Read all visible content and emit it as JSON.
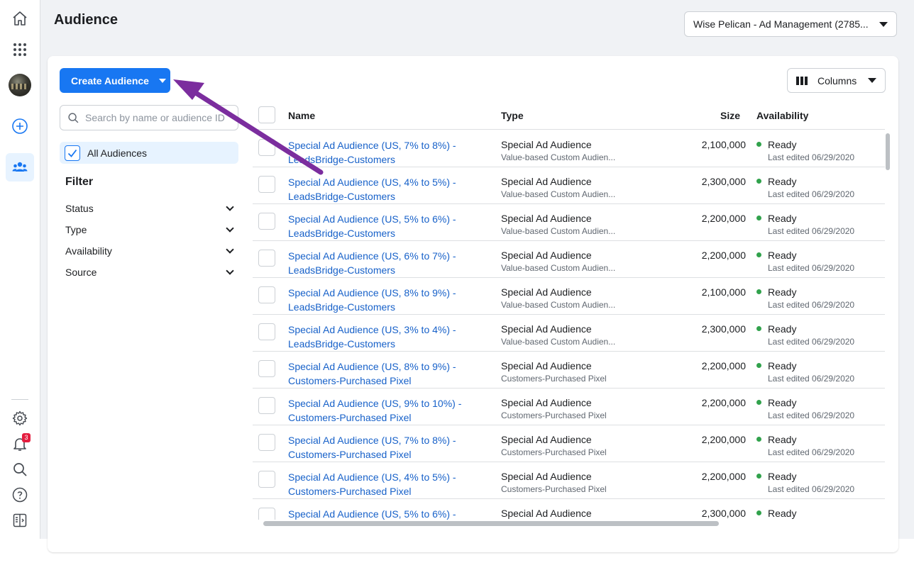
{
  "page": {
    "title": "Audience"
  },
  "account_select": {
    "value": "Wise Pelican - Ad Management (2785..."
  },
  "sidebar": {
    "notifications_count": "3",
    "icons": [
      "home-icon",
      "apps-grid-icon",
      "avatar",
      "add-icon",
      "audiences-icon",
      "settings-icon",
      "bell-icon",
      "search-icon",
      "help-icon",
      "panel-toggle-icon"
    ]
  },
  "toolbar": {
    "create_label": "Create Audience",
    "columns_label": "Columns"
  },
  "search": {
    "placeholder": "Search by name or audience ID"
  },
  "audiences_filter": {
    "all_label": "All Audiences"
  },
  "filter": {
    "title": "Filter",
    "items": [
      "Status",
      "Type",
      "Availability",
      "Source"
    ]
  },
  "table": {
    "headers": {
      "name": "Name",
      "type": "Type",
      "size": "Size",
      "availability": "Availability"
    },
    "rows": [
      {
        "name": "Special Ad Audience (US, 7% to 8%) - LeadsBridge-Customers",
        "type": "Special Ad Audience",
        "subtype": "Value-based Custom Audien...",
        "size": "2,100,000",
        "status": "Ready",
        "edited": "Last edited 06/29/2020"
      },
      {
        "name": "Special Ad Audience (US, 4% to 5%) - LeadsBridge-Customers",
        "type": "Special Ad Audience",
        "subtype": "Value-based Custom Audien...",
        "size": "2,300,000",
        "status": "Ready",
        "edited": "Last edited 06/29/2020"
      },
      {
        "name": "Special Ad Audience (US, 5% to 6%) - LeadsBridge-Customers",
        "type": "Special Ad Audience",
        "subtype": "Value-based Custom Audien...",
        "size": "2,200,000",
        "status": "Ready",
        "edited": "Last edited 06/29/2020"
      },
      {
        "name": "Special Ad Audience (US, 6% to 7%) - LeadsBridge-Customers",
        "type": "Special Ad Audience",
        "subtype": "Value-based Custom Audien...",
        "size": "2,200,000",
        "status": "Ready",
        "edited": "Last edited 06/29/2020"
      },
      {
        "name": "Special Ad Audience (US, 8% to 9%) - LeadsBridge-Customers",
        "type": "Special Ad Audience",
        "subtype": "Value-based Custom Audien...",
        "size": "2,100,000",
        "status": "Ready",
        "edited": "Last edited 06/29/2020"
      },
      {
        "name": "Special Ad Audience (US, 3% to 4%) - LeadsBridge-Customers",
        "type": "Special Ad Audience",
        "subtype": "Value-based Custom Audien...",
        "size": "2,300,000",
        "status": "Ready",
        "edited": "Last edited 06/29/2020"
      },
      {
        "name": "Special Ad Audience (US, 8% to 9%) - Customers-Purchased Pixel",
        "type": "Special Ad Audience",
        "subtype": "Customers-Purchased Pixel",
        "size": "2,200,000",
        "status": "Ready",
        "edited": "Last edited 06/29/2020"
      },
      {
        "name": "Special Ad Audience (US, 9% to 10%) - Customers-Purchased Pixel",
        "type": "Special Ad Audience",
        "subtype": "Customers-Purchased Pixel",
        "size": "2,200,000",
        "status": "Ready",
        "edited": "Last edited 06/29/2020"
      },
      {
        "name": "Special Ad Audience (US, 7% to 8%) - Customers-Purchased Pixel",
        "type": "Special Ad Audience",
        "subtype": "Customers-Purchased Pixel",
        "size": "2,200,000",
        "status": "Ready",
        "edited": "Last edited 06/29/2020"
      },
      {
        "name": "Special Ad Audience (US, 4% to 5%) - Customers-Purchased Pixel",
        "type": "Special Ad Audience",
        "subtype": "Customers-Purchased Pixel",
        "size": "2,200,000",
        "status": "Ready",
        "edited": "Last edited 06/29/2020"
      },
      {
        "name": "Special Ad Audience (US, 5% to 6%) -",
        "type": "Special Ad Audience",
        "subtype": "",
        "size": "2,300,000",
        "status": "Ready",
        "edited": ""
      }
    ]
  },
  "colors": {
    "accent": "#1877f2",
    "link": "#1761c9",
    "ready_dot": "#31a24c",
    "annotation_arrow": "#7b2d9e"
  }
}
